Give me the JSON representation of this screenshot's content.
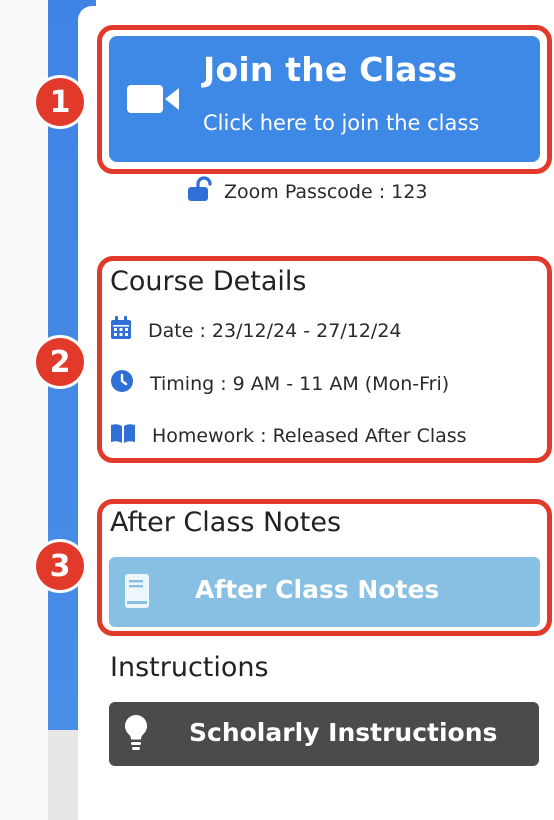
{
  "join": {
    "title": "Join the Class",
    "subtitle": "Click here to join the class"
  },
  "passcode": {
    "text": "Zoom Passcode : 123"
  },
  "course_details": {
    "heading": "Course Details",
    "date": "Date : 23/12/24 - 27/12/24",
    "timing": "Timing : 9 AM - 11 AM (Mon-Fri)",
    "homework": "Homework : Released After Class"
  },
  "after_class": {
    "heading": "After Class Notes",
    "button_label": "After Class Notes"
  },
  "instructions": {
    "heading": "Instructions",
    "button_label": "Scholarly Instructions"
  },
  "annotations": {
    "badge1": "1",
    "badge2": "2",
    "badge3": "3"
  },
  "colors": {
    "primary_blue": "#3e88e6",
    "light_blue": "#88c0e3",
    "dark_gray": "#4b4b4b",
    "annotation_red": "#e23a2a"
  }
}
